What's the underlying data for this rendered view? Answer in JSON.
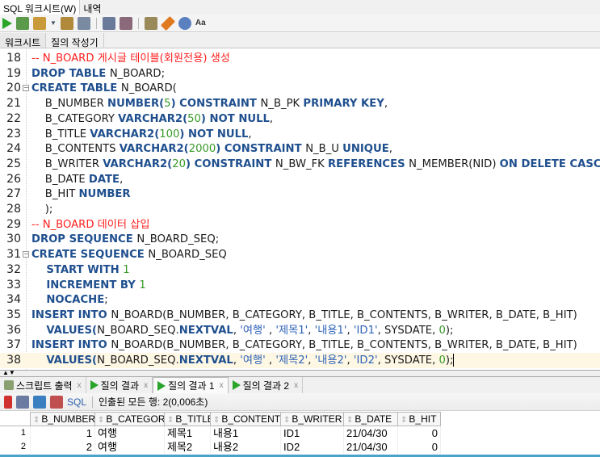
{
  "menu": [
    "SQL 워크시트(W)",
    "내역"
  ],
  "toolbar_icons": [
    "run-statement-icon",
    "run-script-icon",
    "commit-icon",
    "dropdown-icon",
    "explain-plan-icon",
    "autotrace-icon",
    "commit-transaction-icon",
    "rollback-icon",
    "sql-tuning-icon",
    "clear-icon",
    "history-icon",
    "format-icon"
  ],
  "tabs": [
    "워크시트",
    "질의 작성기"
  ],
  "editor": {
    "lines": [
      {
        "n": "18",
        "t": [
          [
            "c",
            "-- N_BOARD 게시글 테이블(회원전용) 생성"
          ]
        ]
      },
      {
        "n": "19",
        "t": [
          [
            "k",
            "DROP TABLE "
          ],
          [
            "i",
            "N_BOARD;"
          ]
        ]
      },
      {
        "n": "20",
        "fold": true,
        "t": [
          [
            "k",
            "CREATE TABLE "
          ],
          [
            "i",
            "N_BOARD("
          ]
        ]
      },
      {
        "n": "21",
        "t": [
          [
            "i",
            "    B_NUMBER "
          ],
          [
            "k",
            "NUMBER("
          ],
          [
            "n",
            "5"
          ],
          [
            "k",
            ") CONSTRAINT "
          ],
          [
            "i",
            "N_B_PK "
          ],
          [
            "k",
            "PRIMARY KEY"
          ],
          [
            "i",
            ","
          ]
        ]
      },
      {
        "n": "22",
        "t": [
          [
            "i",
            "    B_CATEGORY "
          ],
          [
            "k",
            "VARCHAR2("
          ],
          [
            "n",
            "50"
          ],
          [
            "k",
            ") NOT NULL"
          ],
          [
            "i",
            ","
          ]
        ]
      },
      {
        "n": "23",
        "t": [
          [
            "i",
            "    B_TITLE "
          ],
          [
            "k",
            "VARCHAR2("
          ],
          [
            "n",
            "100"
          ],
          [
            "k",
            ") NOT NULL"
          ],
          [
            "i",
            ","
          ]
        ]
      },
      {
        "n": "24",
        "t": [
          [
            "i",
            "    B_CONTENTS "
          ],
          [
            "k",
            "VARCHAR2("
          ],
          [
            "n",
            "2000"
          ],
          [
            "k",
            ") CONSTRAINT "
          ],
          [
            "i",
            "N_B_U "
          ],
          [
            "k",
            "UNIQUE"
          ],
          [
            "i",
            ","
          ]
        ]
      },
      {
        "n": "25",
        "t": [
          [
            "i",
            "    B_WRITER "
          ],
          [
            "k",
            "VARCHAR2("
          ],
          [
            "n",
            "20"
          ],
          [
            "k",
            ") CONSTRAINT "
          ],
          [
            "i",
            "N_BW_FK "
          ],
          [
            "k",
            "REFERENCES "
          ],
          [
            "i",
            "N_MEMBER(NID) "
          ],
          [
            "k",
            "ON DELETE CASCADE"
          ],
          [
            "i",
            ","
          ]
        ]
      },
      {
        "n": "26",
        "t": [
          [
            "i",
            "    B_DATE "
          ],
          [
            "k",
            "DATE"
          ],
          [
            "i",
            ","
          ]
        ]
      },
      {
        "n": "27",
        "t": [
          [
            "i",
            "    B_HIT "
          ],
          [
            "k",
            "NUMBER"
          ]
        ]
      },
      {
        "n": "28",
        "t": [
          [
            "i",
            "    );"
          ]
        ]
      },
      {
        "n": "29",
        "t": [
          [
            "c",
            "-- N_BOARD 데이터 삽입"
          ]
        ]
      },
      {
        "n": "30",
        "t": [
          [
            "k",
            "DROP SEQUENCE "
          ],
          [
            "i",
            "N_BOARD_SEQ;"
          ]
        ]
      },
      {
        "n": "31",
        "fold": true,
        "t": [
          [
            "k",
            "CREATE SEQUENCE "
          ],
          [
            "i",
            "N_BOARD_SEQ"
          ]
        ]
      },
      {
        "n": "32",
        "t": [
          [
            "k",
            "    START WITH "
          ],
          [
            "n",
            "1"
          ]
        ]
      },
      {
        "n": "33",
        "t": [
          [
            "k",
            "    INCREMENT BY "
          ],
          [
            "n",
            "1"
          ]
        ]
      },
      {
        "n": "34",
        "t": [
          [
            "k",
            "    NOCACHE"
          ],
          [
            "i",
            ";"
          ]
        ]
      },
      {
        "n": "35",
        "t": [
          [
            "k",
            "INSERT INTO "
          ],
          [
            "i",
            "N_BOARD(B_NUMBER, B_CATEGORY, B_TITLE, B_CONTENTS, B_WRITER, B_DATE, B_HIT)"
          ]
        ]
      },
      {
        "n": "36",
        "t": [
          [
            "k",
            "    VALUES("
          ],
          [
            "i",
            "N_BOARD_SEQ."
          ],
          [
            "k",
            "NEXTVAL"
          ],
          [
            "i",
            ", "
          ],
          [
            "s",
            "'여행'"
          ],
          [
            "i",
            " , "
          ],
          [
            "s",
            "'제목1'"
          ],
          [
            "i",
            ", "
          ],
          [
            "s",
            "'내용1'"
          ],
          [
            "i",
            ", "
          ],
          [
            "s",
            "'ID1'"
          ],
          [
            "i",
            ", SYSDATE, "
          ],
          [
            "n",
            "0"
          ],
          [
            "i",
            ");"
          ]
        ]
      },
      {
        "n": "37",
        "t": [
          [
            "k",
            "INSERT INTO "
          ],
          [
            "i",
            "N_BOARD(B_NUMBER, B_CATEGORY, B_TITLE, B_CONTENTS, B_WRITER, B_DATE, B_HIT)"
          ]
        ]
      },
      {
        "n": "38",
        "current": true,
        "t": [
          [
            "k",
            "    VALUES("
          ],
          [
            "i",
            "N_BOARD_SEQ."
          ],
          [
            "k",
            "NEXTVAL"
          ],
          [
            "i",
            ", "
          ],
          [
            "s",
            "'여행'"
          ],
          [
            "i",
            " , "
          ],
          [
            "s",
            "'제목2'"
          ],
          [
            "i",
            ", "
          ],
          [
            "s",
            "'내용2'"
          ],
          [
            "i",
            ", "
          ],
          [
            "s",
            "'ID2'"
          ],
          [
            "i",
            ", SYSDATE, "
          ],
          [
            "n",
            "0"
          ],
          [
            "i",
            ");"
          ]
        ]
      }
    ]
  },
  "result_tabs": [
    {
      "label": "스크립트 출력",
      "icon": "script-output-icon"
    },
    {
      "label": "질의 결과",
      "icon": "run-icon"
    },
    {
      "label": "질의 결과 1",
      "icon": "run-icon",
      "active": true
    },
    {
      "label": "질의 결과 2",
      "icon": "run-icon"
    }
  ],
  "result_toolbar": {
    "sql_label": "SQL",
    "status": "인출된 모든 행: 2(0,006초)"
  },
  "grid": {
    "columns": [
      "B_NUMBER",
      "B_CATEGORY",
      "B_TITLE",
      "B_CONTENTS",
      "B_WRITER",
      "B_DATE",
      "B_HIT"
    ],
    "rows": [
      {
        "idx": "1",
        "cells": [
          "1",
          "여행",
          "제목1",
          "내용1",
          "ID1",
          "21/04/30",
          "0"
        ]
      },
      {
        "idx": "2",
        "cells": [
          "2",
          "여행",
          "제목2",
          "내용2",
          "ID2",
          "21/04/30",
          "0"
        ]
      }
    ]
  }
}
